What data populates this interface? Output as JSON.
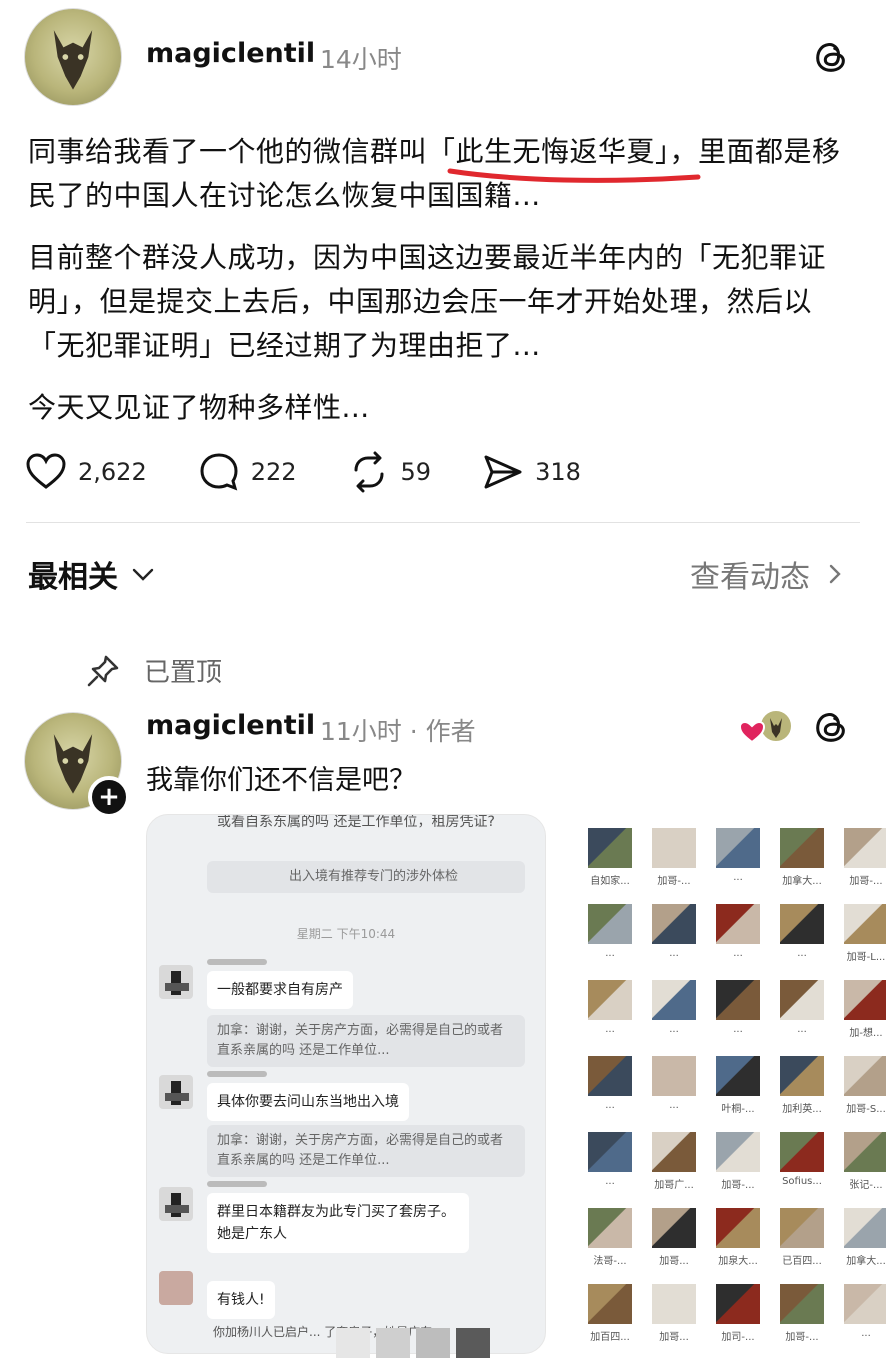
{
  "post": {
    "username": "magiclentil",
    "time": "14小时",
    "paragraphs": [
      "同事给我看了一个他的微信群叫「此生无悔返华夏」，里面都是移民了的中国人在讨论怎么恢复中国国籍...",
      "目前整个群没人成功，因为中国这边要最近半年内的「无犯罪证明」，但是提交上去后，中国那边会压一年才开始处理，然后以「无犯罪证明」已经过期了为理由拒了...",
      "今天又见证了物种多样性..."
    ],
    "stats": {
      "likes": "2,622",
      "comments": "222",
      "reposts": "59",
      "shares": "318"
    }
  },
  "sort": {
    "label": "最相关",
    "activity_label": "查看动态"
  },
  "pinned_label": "已置顶",
  "reply": {
    "username": "magiclentil",
    "meta": "11小时 · 作者",
    "text": "我靠你们还不信是吧？",
    "plus": "+"
  },
  "chat": {
    "top_text": "或看自系东属的吗 还是工作单位，租房凭证?",
    "quote1": "出入境有推荐专门的涉外体检",
    "timestamp": "星期二 下午10:44",
    "messages": [
      "一般都要求自有房产",
      "具体你要去问山东当地出入境",
      "群里日本籍群友为此专门买了套房子。她是广东人",
      "有钱人!"
    ],
    "quote2": "加拿：谢谢，关于房产方面，必需得是自己的或者直系亲属的吗 还是工作单位...",
    "quote3": "加拿：谢谢，关于房产方面，必需得是自己的或者直系亲属的吗 还是工作单位...",
    "bottom_text": "你加杨川人已启户... 了套房子，她是广东"
  },
  "grid_names": [
    "自如家...",
    "加哥-...",
    "...",
    "加拿大...",
    "加哥-...",
    "...",
    "...",
    "...",
    "...",
    "加哥-L...",
    "...",
    "...",
    "...",
    "...",
    "加-想...",
    "...",
    "...",
    "叶桐-...",
    "加利英...",
    "加哥-S...",
    "...",
    "加哥广...",
    "加哥-...",
    "Sofius...",
    "张记-...",
    "法哥-...",
    "加哥...",
    "加泉大...",
    "已百四...",
    "加拿大...",
    "加百四...",
    "加哥...",
    "加司-...",
    "加哥-...",
    "...",
    "..."
  ],
  "colors": {
    "text": "#111111",
    "muted": "#888888",
    "accent_underline": "#e0282e",
    "heart_red": "#e0245e"
  }
}
